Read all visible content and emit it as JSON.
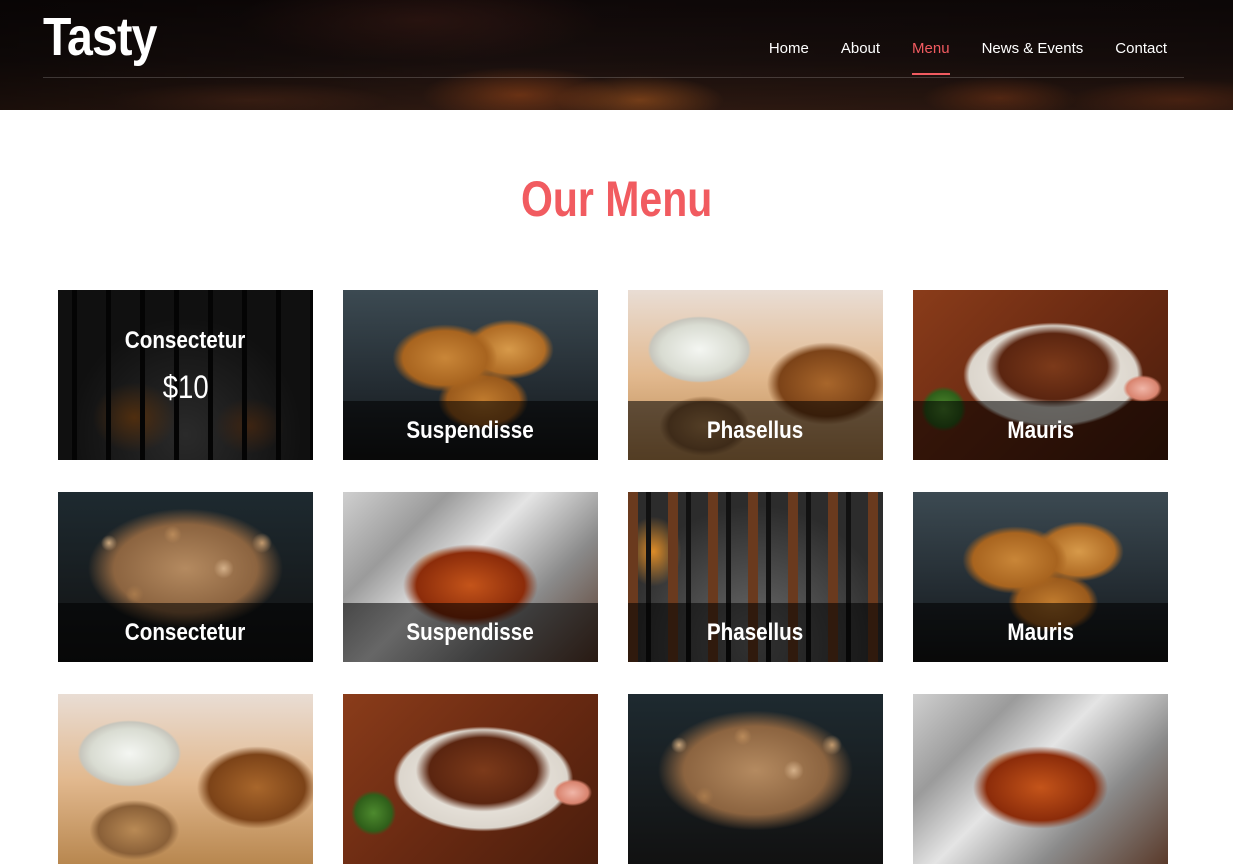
{
  "header": {
    "logo": "Tasty",
    "nav": [
      {
        "label": "Home"
      },
      {
        "label": "About"
      },
      {
        "label": "Menu",
        "active": true
      },
      {
        "label": "News & Events"
      },
      {
        "label": "Contact"
      }
    ]
  },
  "title": "Our Menu",
  "accent_color": "#f15b60",
  "menu": {
    "items": [
      {
        "label": "Consectetur",
        "price": "$10",
        "image": "grill"
      },
      {
        "label": "Suspendisse",
        "image": "chicken"
      },
      {
        "label": "Phasellus",
        "image": "plate"
      },
      {
        "label": "Mauris",
        "image": "wings"
      },
      {
        "label": "Consectetur",
        "image": "pan"
      },
      {
        "label": "Suspendisse",
        "image": "foil"
      },
      {
        "label": "Phasellus",
        "image": "skewers"
      },
      {
        "label": "Mauris",
        "image": "chicken"
      },
      {
        "label": "",
        "image": "plate"
      },
      {
        "label": "",
        "image": "wings"
      },
      {
        "label": "",
        "image": "pan"
      },
      {
        "label": "",
        "image": "foil"
      }
    ]
  }
}
